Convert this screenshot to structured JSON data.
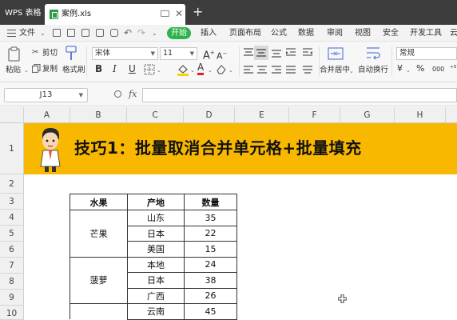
{
  "titlebar": {
    "app_tab": "WPS 表格",
    "file_tab": "案例.xls"
  },
  "menu": {
    "file": "文件",
    "start": "开始",
    "items": [
      "插入",
      "页面布局",
      "公式",
      "数据",
      "审阅",
      "视图",
      "安全",
      "开发工具",
      "云"
    ]
  },
  "ribbon": {
    "paste": "粘贴",
    "cut": "剪切",
    "copy": "复制",
    "format_painter": "格式刷",
    "font_name": "宋体",
    "font_size": "11",
    "merge_center": "合并居中",
    "wrap_text": "自动换行",
    "number_format": "常规",
    "bold": "B",
    "italic": "I",
    "underline": "U",
    "font_color_letter": "A",
    "grow_font": "A",
    "shrink_font": "A",
    "percent": "%",
    "thousands": "000"
  },
  "formula_bar": {
    "cell_ref": "J13",
    "fx": "fx",
    "value": ""
  },
  "columns": [
    "A",
    "B",
    "C",
    "D",
    "E",
    "F",
    "G",
    "H"
  ],
  "rows": [
    "1",
    "2",
    "3",
    "4",
    "5",
    "6",
    "7",
    "8",
    "9",
    "10"
  ],
  "banner": {
    "title": "技巧1：批量取消合并单元格+批量填充"
  },
  "table": {
    "headers": [
      "水果",
      "产地",
      "数量"
    ],
    "groups": [
      {
        "fruit": "芒果",
        "rows": [
          [
            "山东",
            "35"
          ],
          [
            "日本",
            "22"
          ],
          [
            "美国",
            "15"
          ]
        ]
      },
      {
        "fruit": "菠萝",
        "rows": [
          [
            "本地",
            "24"
          ],
          [
            "日本",
            "38"
          ],
          [
            "广西",
            "26"
          ]
        ]
      },
      {
        "fruit": "",
        "rows": [
          [
            "云南",
            "45"
          ]
        ]
      }
    ]
  },
  "colors": {
    "banner": "#f9b800",
    "start_button": "#2eb34a",
    "titlebar": "#3c3c3c"
  }
}
